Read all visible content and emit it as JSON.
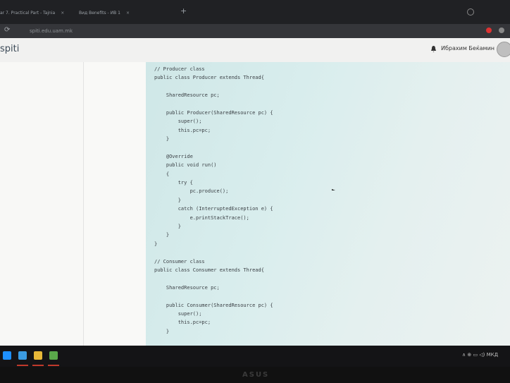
{
  "browser": {
    "tabs": [
      {
        "label": "ar 7. Practical Part - Tajnia",
        "close": "×"
      },
      {
        "label": "Вид Benefits - ИВ 1",
        "close": "×"
      }
    ],
    "new_tab": "+",
    "url": "spiti.edu.uam.mk"
  },
  "page": {
    "brand": "spiti",
    "user_name": "Ибрахим Беќамин"
  },
  "code_lines": [
    "// Producer class",
    "public class Producer extends Thread{",
    "",
    "    SharedResource pc;",
    "",
    "    public Producer(SharedResource pc) {",
    "        super();",
    "        this.pc=pc;",
    "    }",
    "",
    "    @Override",
    "    public void run()",
    "    {",
    "        try {",
    "            pc.produce();",
    "        }",
    "        catch (InterruptedException e) {",
    "            e.printStackTrace();",
    "        }",
    "    }",
    "}",
    "",
    "// Consumer class",
    "public class Consumer extends Thread{",
    "",
    "    SharedResource pc;",
    "",
    "    public Consumer(SharedResource pc) {",
    "        super();",
    "        this.pc=pc;",
    "    }"
  ],
  "taskbar": {
    "tray_text": "∧ ⊕ ▭ ◁) МКД"
  },
  "bezel_logo": "ASUS"
}
